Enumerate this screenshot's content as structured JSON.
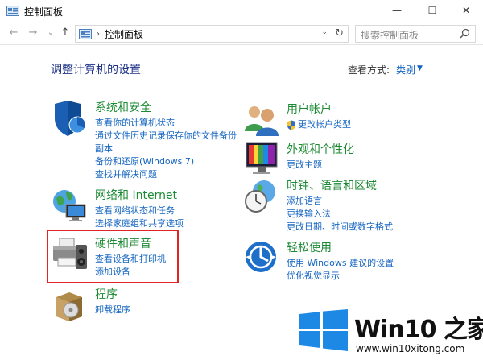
{
  "window": {
    "title": "控制面板",
    "min_glyph": "—",
    "max_glyph": "☐",
    "close_glyph": "✕"
  },
  "nav": {
    "back_glyph": "←",
    "forward_glyph": "→",
    "recent_glyph": "⌄",
    "up_glyph": "↑"
  },
  "address": {
    "separator": "›",
    "path": "控制面板",
    "dropdown_glyph": "⌄",
    "refresh_glyph": "↻"
  },
  "search": {
    "placeholder": "搜索控制面板"
  },
  "header": {
    "title": "调整计算机的设置",
    "view_label": "查看方式:",
    "view_value": "类别",
    "view_arrow": "▼"
  },
  "categories": [
    {
      "title": "系统和安全",
      "links": [
        "查看你的计算机状态",
        "通过文件历史记录保存你的文件备份",
        "副本",
        "备份和还原(Windows 7)",
        "查找并解决问题"
      ]
    },
    {
      "title": "网络和 Internet",
      "links": [
        "查看网络状态和任务",
        "选择家庭组和共享选项"
      ]
    },
    {
      "title": "硬件和声音",
      "links": [
        "查看设备和打印机",
        "添加设备"
      ]
    },
    {
      "title": "程序",
      "links": [
        "卸载程序"
      ]
    },
    {
      "title": "用户帐户",
      "links": [
        "更改帐户类型"
      ]
    },
    {
      "title": "外观和个性化",
      "links": [
        "更改主题"
      ]
    },
    {
      "title": "时钟、语言和区域",
      "links": [
        "添加语言",
        "更换输入法",
        "更改日期、时间或数字格式"
      ]
    },
    {
      "title": "轻松使用",
      "links": [
        "使用 Windows 建议的设置",
        "优化视觉显示"
      ]
    }
  ],
  "watermark": {
    "brand": "Win10",
    "brand_suffix": "之家",
    "url": "www.win10xitong.com"
  },
  "colors": {
    "category_title": "#1c8a34",
    "link": "#1565c0",
    "highlight": "#e02525",
    "watermark_blue": "#1e88e5"
  }
}
